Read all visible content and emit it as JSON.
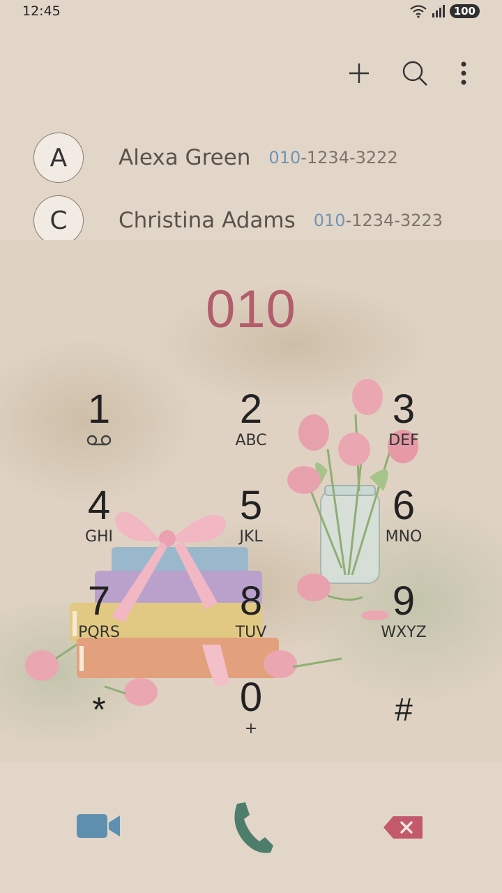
{
  "status_bar": {
    "time": "12:45",
    "battery": "100"
  },
  "toolbar": {
    "add_icon": "plus-icon",
    "search_icon": "search-icon",
    "more_icon": "more-vert-icon"
  },
  "contacts": [
    {
      "initial": "A",
      "name": "Alexa Green",
      "number_match": "010",
      "number_rest": "-1234-3222"
    },
    {
      "initial": "C",
      "name": "Christina Adams",
      "number_match": "010",
      "number_rest": "-1234-3223"
    }
  ],
  "dialer": {
    "entry": "010",
    "keys": [
      {
        "digit": "1",
        "letters": ""
      },
      {
        "digit": "2",
        "letters": "ABC"
      },
      {
        "digit": "3",
        "letters": "DEF"
      },
      {
        "digit": "4",
        "letters": "GHI"
      },
      {
        "digit": "5",
        "letters": "JKL"
      },
      {
        "digit": "6",
        "letters": "MNO"
      },
      {
        "digit": "7",
        "letters": "PQRS"
      },
      {
        "digit": "8",
        "letters": "TUV"
      },
      {
        "digit": "9",
        "letters": "WXYZ"
      },
      {
        "digit": "*",
        "letters": ""
      },
      {
        "digit": "0",
        "letters": "+"
      },
      {
        "digit": "#",
        "letters": ""
      }
    ]
  },
  "colors": {
    "accent": "#b35d6c",
    "video": "#5e8fae",
    "call": "#4e7d6b",
    "delete": "#c25a6c"
  }
}
